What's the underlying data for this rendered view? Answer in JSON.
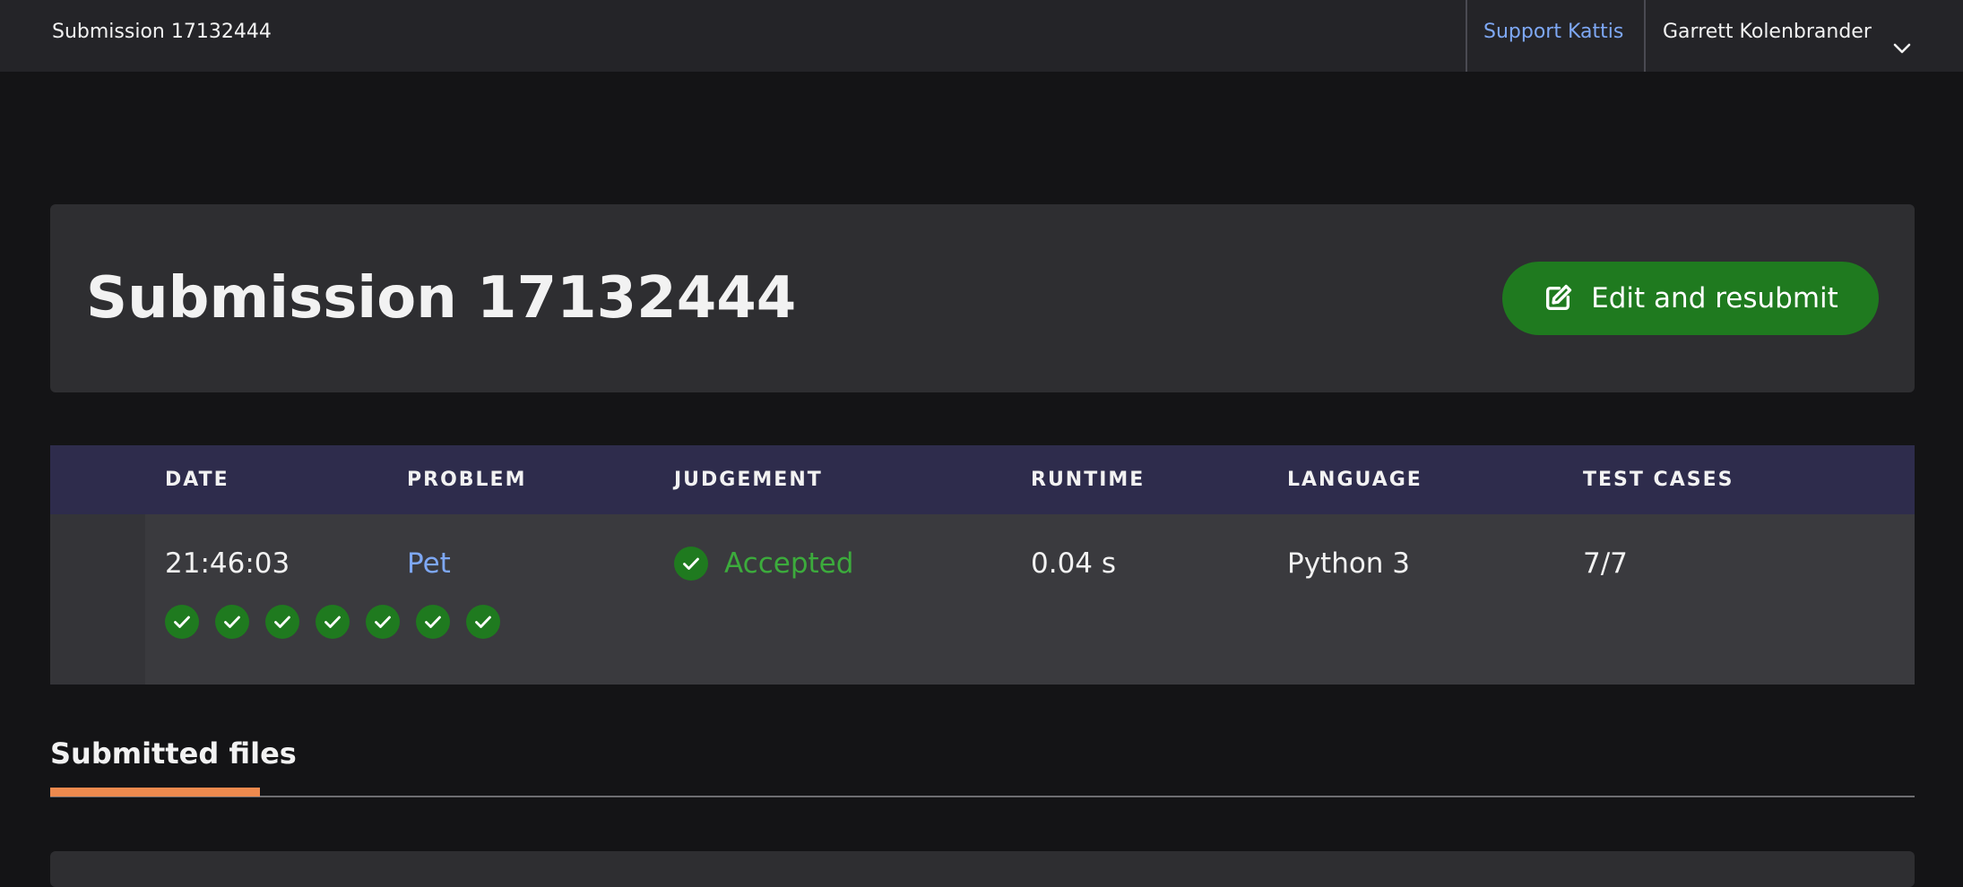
{
  "topbar": {
    "title": "Submission 17132444",
    "support_link": "Support Kattis",
    "user_name": "Garrett Kolenbrander"
  },
  "header": {
    "title": "Submission 17132444",
    "resubmit_label": "Edit and resubmit"
  },
  "table": {
    "columns": [
      "DATE",
      "PROBLEM",
      "JUDGEMENT",
      "RUNTIME",
      "LANGUAGE",
      "TEST CASES"
    ],
    "row": {
      "date": "21:46:03",
      "problem": "Pet",
      "judgement": "Accepted",
      "runtime": "0.04 s",
      "language": "Python 3",
      "test_cases": "7/7"
    },
    "test_case_results": [
      "passed",
      "passed",
      "passed",
      "passed",
      "passed",
      "passed",
      "passed"
    ]
  },
  "tabs": {
    "active": "Submitted files"
  },
  "colors": {
    "accent_green": "#1f7a1f",
    "accepted_text": "#3cab3c",
    "link_blue": "#7ea8f5",
    "tab_underline": "#ee8a4e",
    "table_header_bg": "#2e2c4c"
  },
  "icons": {
    "user_menu": "chevron-down-icon",
    "resubmit": "edit-icon",
    "judgement": "check-circle-icon",
    "test_case": "check-circle-icon"
  }
}
